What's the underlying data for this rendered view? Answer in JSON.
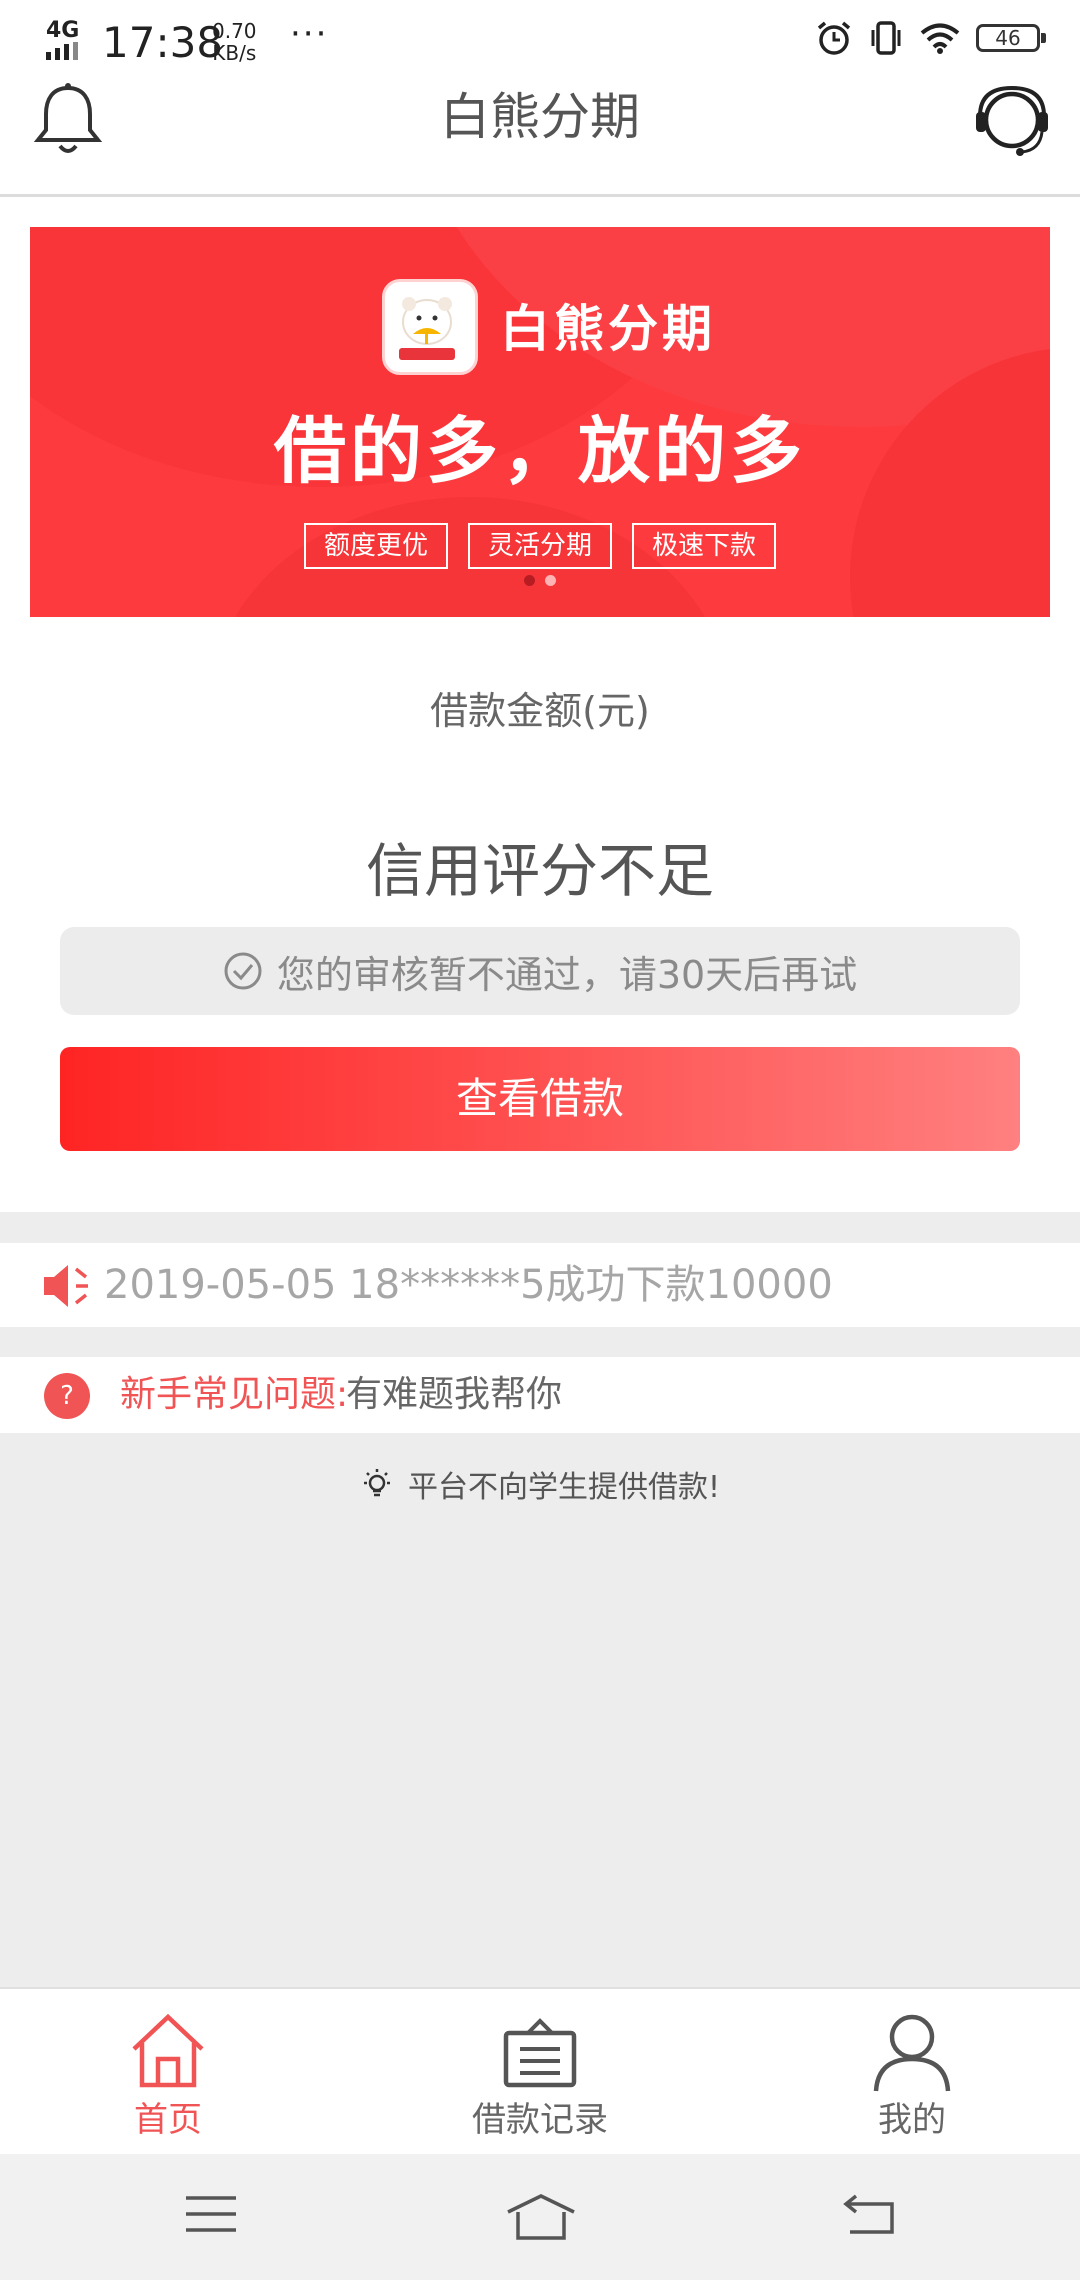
{
  "status_bar": {
    "network": "4G",
    "time": "17:38",
    "speed_value": "0.70",
    "speed_unit": "KB/s",
    "more": "···",
    "battery": "46"
  },
  "header": {
    "title": "白熊分期"
  },
  "banner": {
    "brand": "白熊分期",
    "slogan": "借的多，放的多",
    "tags": [
      "额度更优",
      "灵活分期",
      "极速下款"
    ],
    "slide_count": 2,
    "active_slide": 0
  },
  "loan": {
    "amount_label": "借款金额(元)",
    "credit_title": "信用评分不足",
    "review_notice": "您的审核暂不通过，请30天后再试",
    "button": "查看借款"
  },
  "ticker": {
    "text": "2019-05-05 18******5成功下款10000"
  },
  "faq": {
    "title": "新手常见问题:",
    "subtitle": "有难题我帮你",
    "icon": "?"
  },
  "tip": {
    "text": "平台不向学生提供借款!"
  },
  "tabs": [
    {
      "label": "首页",
      "icon": "home-icon",
      "active": true
    },
    {
      "label": "借款记录",
      "icon": "record-icon",
      "active": false
    },
    {
      "label": "我的",
      "icon": "user-icon",
      "active": false
    }
  ],
  "colors": {
    "accent": "#f05454",
    "banner_red": "#fd3a3e",
    "button_start": "#ff2424",
    "button_end": "#ff8080"
  }
}
